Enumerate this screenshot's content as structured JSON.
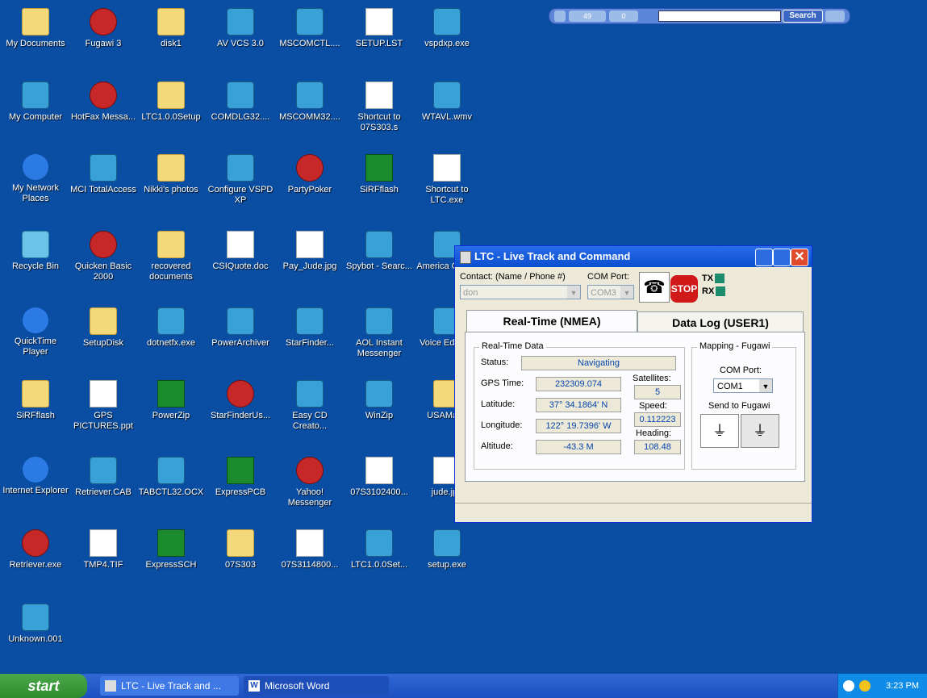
{
  "desktop": {
    "icons": [
      {
        "label": "My Documents",
        "kind": "ico-folder"
      },
      {
        "label": "Fugawi 3",
        "kind": "ico-red"
      },
      {
        "label": "disk1",
        "kind": "ico-folder"
      },
      {
        "label": "AV VCS 3.0",
        "kind": "ico-app"
      },
      {
        "label": "MSCOMCTL....",
        "kind": "ico-app"
      },
      {
        "label": "SETUP.LST",
        "kind": "ico-doc"
      },
      {
        "label": "vspdxp.exe",
        "kind": "ico-app"
      },
      {
        "label": "My Computer",
        "kind": "ico-app"
      },
      {
        "label": "HotFax Messa...",
        "kind": "ico-red"
      },
      {
        "label": "LTC1.0.0Setup",
        "kind": "ico-folder"
      },
      {
        "label": "COMDLG32....",
        "kind": "ico-app"
      },
      {
        "label": "MSCOMM32....",
        "kind": "ico-app"
      },
      {
        "label": "Shortcut to 07S303.s",
        "kind": "ico-doc"
      },
      {
        "label": "WTAVL.wmv",
        "kind": "ico-app"
      },
      {
        "label": "My Network Places",
        "kind": "ico-ie"
      },
      {
        "label": "MCI TotalAccess",
        "kind": "ico-app"
      },
      {
        "label": "Nikki's photos",
        "kind": "ico-folder"
      },
      {
        "label": "Configure VSPD XP",
        "kind": "ico-app"
      },
      {
        "label": "PartyPoker",
        "kind": "ico-red"
      },
      {
        "label": "SiRFflash",
        "kind": "ico-green"
      },
      {
        "label": "Shortcut to LTC.exe",
        "kind": "ico-doc"
      },
      {
        "label": "Recycle Bin",
        "kind": "ico-bin"
      },
      {
        "label": "Quicken Basic 2000",
        "kind": "ico-red"
      },
      {
        "label": "recovered documents",
        "kind": "ico-folder"
      },
      {
        "label": "CSIQuote.doc",
        "kind": "ico-doc"
      },
      {
        "label": "Pay_Jude.jpg",
        "kind": "ico-doc"
      },
      {
        "label": "Spybot - Searc...",
        "kind": "ico-app"
      },
      {
        "label": "America Online",
        "kind": "ico-app"
      },
      {
        "label": "QuickTime Player",
        "kind": "ico-ie"
      },
      {
        "label": "SetupDisk",
        "kind": "ico-folder"
      },
      {
        "label": "dotnetfx.exe",
        "kind": "ico-app"
      },
      {
        "label": "PowerArchiver",
        "kind": "ico-app"
      },
      {
        "label": "StarFinder...",
        "kind": "ico-app"
      },
      {
        "label": "AOL Instant Messenger",
        "kind": "ico-app"
      },
      {
        "label": "Voice Editor 3",
        "kind": "ico-app"
      },
      {
        "label": "SiRFflash",
        "kind": "ico-folder"
      },
      {
        "label": "GPS PICTURES.ppt",
        "kind": "ico-doc"
      },
      {
        "label": "PowerZip",
        "kind": "ico-green"
      },
      {
        "label": "StarFinderUs...",
        "kind": "ico-red"
      },
      {
        "label": "Easy CD Creato...",
        "kind": "ico-app"
      },
      {
        "label": "WinZip",
        "kind": "ico-app"
      },
      {
        "label": "USAMaps",
        "kind": "ico-folder"
      },
      {
        "label": "Internet Explorer",
        "kind": "ico-ie"
      },
      {
        "label": "Retriever.CAB",
        "kind": "ico-app"
      },
      {
        "label": "TABCTL32.OCX",
        "kind": "ico-app"
      },
      {
        "label": "ExpressPCB",
        "kind": "ico-green"
      },
      {
        "label": "Yahoo! Messenger",
        "kind": "ico-red"
      },
      {
        "label": "07S3102400...",
        "kind": "ico-doc"
      },
      {
        "label": "jude.jpg",
        "kind": "ico-doc"
      },
      {
        "label": "Retriever.exe",
        "kind": "ico-red"
      },
      {
        "label": "TMP4.TIF",
        "kind": "ico-doc"
      },
      {
        "label": "ExpressSCH",
        "kind": "ico-green"
      },
      {
        "label": "07S303",
        "kind": "ico-folder"
      },
      {
        "label": "07S3114800...",
        "kind": "ico-doc"
      },
      {
        "label": "LTC1.0.0Set...",
        "kind": "ico-app"
      },
      {
        "label": "setup.exe",
        "kind": "ico-app"
      },
      {
        "label": "Unknown.001",
        "kind": "ico-app"
      }
    ]
  },
  "toolbar": {
    "count_a": "49",
    "count_b": "0",
    "search_label": "Search"
  },
  "ltc": {
    "title": "LTC - Live Track and Command",
    "contact_label": "Contact: (Name / Phone #)",
    "contact_value": "don",
    "com_port_label": "COM Port:",
    "com_port_value": "COM3",
    "stop_label": "STOP",
    "tx_label": "TX",
    "rx_label": "RX",
    "tabs": [
      {
        "label": "Real-Time (NMEA)"
      },
      {
        "label": "Data Log (USER1)"
      }
    ],
    "realtime_group": "Real-Time Data",
    "status_label": "Status:",
    "status_value": "Navigating",
    "gps_time_label": "GPS Time:",
    "gps_time_value": "232309.074",
    "latitude_label": "Latitude:",
    "latitude_value": "37° 34.1864' N",
    "longitude_label": "Longitude:",
    "longitude_value": "122° 19.7396' W",
    "altitude_label": "Altitude:",
    "altitude_value": "-43.3 M",
    "satellites_label": "Satellites:",
    "satellites_value": "5",
    "speed_label": "Speed:",
    "speed_value": "0.112223",
    "heading_label": "Heading:",
    "heading_value": "108.48",
    "mapping_group": "Mapping - Fugawi",
    "map_com_label": "COM Port:",
    "map_com_value": "COM1",
    "send_label": "Send to Fugawi"
  },
  "taskbar": {
    "start_label": "start",
    "buttons": [
      {
        "label": "LTC - Live Track and ..."
      },
      {
        "label": "Microsoft Word"
      }
    ],
    "clock": "3:23 PM"
  }
}
